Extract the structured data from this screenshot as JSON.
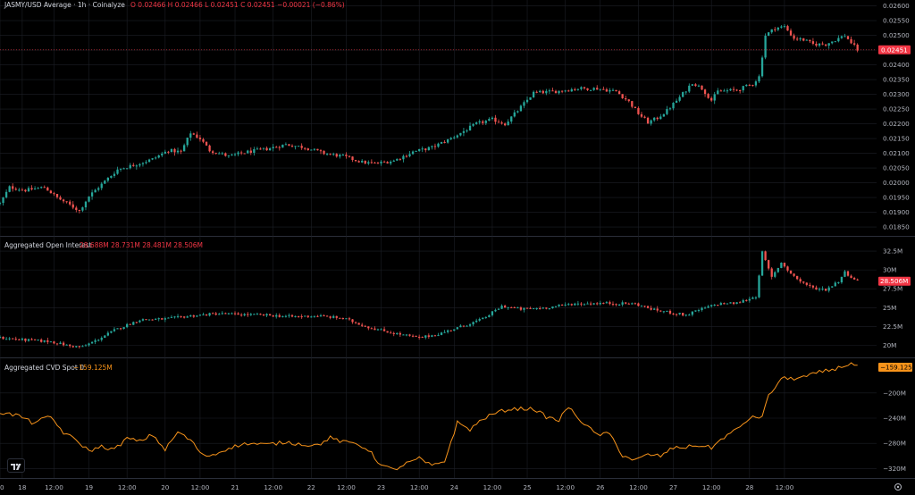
{
  "header": {
    "symbol_line": "JASMY/USD Average · 1h · Coinalyze",
    "ohlc": "O 0.02466  H 0.02466  L 0.02451  C 0.02451  −0.00021 (−0.86%)"
  },
  "panes": {
    "oi_title": "Aggregated Open Interest",
    "oi_values": "28.688M  28.731M  28.481M  28.506M",
    "cvd_title": "Aggregated CVD Spot 0",
    "cvd_value": "−159.125M"
  },
  "colors": {
    "up": "#26a69a",
    "down": "#ef5350",
    "cvd_line": "#f7931a",
    "last_price_tag": "#f23645",
    "cvd_tag": "#f7931a",
    "grid": "#1c1f26",
    "separator": "#2a2e39",
    "axis_text": "#b2b5be"
  },
  "icons": [
    "tradingview-logo-icon",
    "gear-icon"
  ],
  "chart_data": [
    {
      "type": "candlestick",
      "title": "JASMY/USD Average · 1h · Coinalyze",
      "y_ticks": [
        "0.02600",
        "0.02550",
        "0.02500",
        "0.02450",
        "0.02400",
        "0.02350",
        "0.02300",
        "0.02250",
        "0.02200",
        "0.02150",
        "0.02100",
        "0.02050",
        "0.02000",
        "0.01950",
        "0.01900",
        "0.01850"
      ],
      "ylim": [
        0.0182,
        0.0262
      ],
      "last_value_label": "0.02451",
      "x_ticks": [
        "00",
        "18",
        "12:00",
        "19",
        "12:00",
        "20",
        "12:00",
        "21",
        "12:00",
        "22",
        "12:00",
        "23",
        "12:00",
        "24",
        "12:00",
        "25",
        "12:00",
        "26",
        "12:00",
        "27",
        "12:00",
        "28",
        "12:00"
      ],
      "xlim": [
        0,
        276
      ],
      "anchors": [
        [
          0,
          0.0193
        ],
        [
          3,
          0.01985
        ],
        [
          8,
          0.01975
        ],
        [
          14,
          0.01985
        ],
        [
          18,
          0.0195
        ],
        [
          22,
          0.01925
        ],
        [
          25,
          0.01905
        ],
        [
          28,
          0.01955
        ],
        [
          33,
          0.02005
        ],
        [
          37,
          0.02045
        ],
        [
          42,
          0.0206
        ],
        [
          48,
          0.0208
        ],
        [
          53,
          0.0211
        ],
        [
          57,
          0.02105
        ],
        [
          60,
          0.0217
        ],
        [
          63,
          0.0215
        ],
        [
          66,
          0.0211
        ],
        [
          72,
          0.0209
        ],
        [
          78,
          0.02105
        ],
        [
          84,
          0.02115
        ],
        [
          90,
          0.0213
        ],
        [
          96,
          0.0212
        ],
        [
          102,
          0.021
        ],
        [
          108,
          0.0209
        ],
        [
          114,
          0.0207
        ],
        [
          118,
          0.02065
        ],
        [
          124,
          0.02075
        ],
        [
          130,
          0.02105
        ],
        [
          136,
          0.0212
        ],
        [
          141,
          0.02145
        ],
        [
          146,
          0.02175
        ],
        [
          150,
          0.022
        ],
        [
          155,
          0.02215
        ],
        [
          159,
          0.022
        ],
        [
          163,
          0.02245
        ],
        [
          168,
          0.02305
        ],
        [
          175,
          0.0231
        ],
        [
          182,
          0.0232
        ],
        [
          188,
          0.0232
        ],
        [
          194,
          0.0231
        ],
        [
          198,
          0.02275
        ],
        [
          201,
          0.02235
        ],
        [
          204,
          0.02205
        ],
        [
          207,
          0.0222
        ],
        [
          210,
          0.02245
        ],
        [
          214,
          0.0229
        ],
        [
          218,
          0.0234
        ],
        [
          221,
          0.0232
        ],
        [
          224,
          0.0228
        ],
        [
          226,
          0.0231
        ],
        [
          232,
          0.02315
        ],
        [
          237,
          0.02335
        ],
        [
          239,
          0.0236
        ],
        [
          241,
          0.025
        ],
        [
          244,
          0.02525
        ],
        [
          247,
          0.0253
        ],
        [
          250,
          0.0249
        ],
        [
          253,
          0.02485
        ],
        [
          256,
          0.0247
        ],
        [
          260,
          0.0247
        ],
        [
          263,
          0.02485
        ],
        [
          266,
          0.025
        ],
        [
          268,
          0.02475
        ],
        [
          270,
          0.02451
        ]
      ]
    },
    {
      "type": "candlestick",
      "title": "Aggregated Open Interest",
      "y_ticks": [
        "32.5M",
        "30M",
        "27.5M",
        "25M",
        "22.5M",
        "20M"
      ],
      "ylim": [
        18.4,
        34.4
      ],
      "last_value_label": "28.506M",
      "anchors": [
        [
          0,
          21.0
        ],
        [
          8,
          20.7
        ],
        [
          16,
          20.5
        ],
        [
          22,
          19.9
        ],
        [
          26,
          19.8
        ],
        [
          30,
          20.6
        ],
        [
          36,
          22.0
        ],
        [
          44,
          23.4
        ],
        [
          52,
          23.5
        ],
        [
          60,
          23.9
        ],
        [
          68,
          24.2
        ],
        [
          76,
          24.1
        ],
        [
          84,
          24.0
        ],
        [
          92,
          23.8
        ],
        [
          100,
          23.9
        ],
        [
          108,
          23.6
        ],
        [
          116,
          22.4
        ],
        [
          124,
          21.6
        ],
        [
          132,
          21.0
        ],
        [
          138,
          21.5
        ],
        [
          146,
          22.6
        ],
        [
          152,
          23.5
        ],
        [
          158,
          25.2
        ],
        [
          164,
          24.8
        ],
        [
          172,
          25.0
        ],
        [
          180,
          25.5
        ],
        [
          190,
          25.6
        ],
        [
          200,
          25.5
        ],
        [
          206,
          24.7
        ],
        [
          212,
          24.3
        ],
        [
          216,
          24.0
        ],
        [
          220,
          24.7
        ],
        [
          226,
          25.5
        ],
        [
          232,
          25.6
        ],
        [
          238,
          26.5
        ],
        [
          240,
          32.3
        ],
        [
          243,
          29.0
        ],
        [
          246,
          31.0
        ],
        [
          249,
          29.5
        ],
        [
          252,
          28.5
        ],
        [
          256,
          27.6
        ],
        [
          260,
          27.4
        ],
        [
          264,
          28.5
        ],
        [
          266,
          29.7
        ],
        [
          270,
          28.5
        ]
      ]
    },
    {
      "type": "line",
      "title": "Aggregated CVD Spot 0",
      "y_ticks": [
        "−200M",
        "−240M",
        "−280M",
        "−320M"
      ],
      "ylim": [
        -335,
        -145
      ],
      "last_value_label": "−159.125M",
      "x": [
        0,
        6,
        10,
        16,
        20,
        24,
        28,
        32,
        36,
        40,
        44,
        48,
        52,
        56,
        60,
        64,
        68,
        72,
        78,
        84,
        90,
        96,
        100,
        104,
        108,
        112,
        116,
        120,
        124,
        128,
        132,
        136,
        140,
        144,
        148,
        152,
        156,
        160,
        164,
        168,
        172,
        176,
        178,
        180,
        184,
        188,
        192,
        196,
        200,
        204,
        208,
        212,
        216,
        220,
        224,
        228,
        232,
        236,
        240,
        242,
        246,
        250,
        254,
        258,
        262,
        264,
        268,
        270
      ],
      "values": [
        -231,
        -236,
        -247,
        -238,
        -263,
        -275,
        -292,
        -285,
        -290,
        -272,
        -277,
        -266,
        -290,
        -262,
        -275,
        -300,
        -297,
        -287,
        -280,
        -282,
        -278,
        -282,
        -283,
        -271,
        -278,
        -280,
        -290,
        -315,
        -322,
        -312,
        -304,
        -316,
        -308,
        -247,
        -258,
        -241,
        -232,
        -226,
        -225,
        -225,
        -238,
        -244,
        -226,
        -227,
        -250,
        -266,
        -265,
        -299,
        -307,
        -298,
        -300,
        -287,
        -286,
        -283,
        -287,
        -270,
        -258,
        -240,
        -237,
        -205,
        -177,
        -177,
        -174,
        -167,
        -163,
        -160,
        -153,
        -159
      ]
    }
  ]
}
